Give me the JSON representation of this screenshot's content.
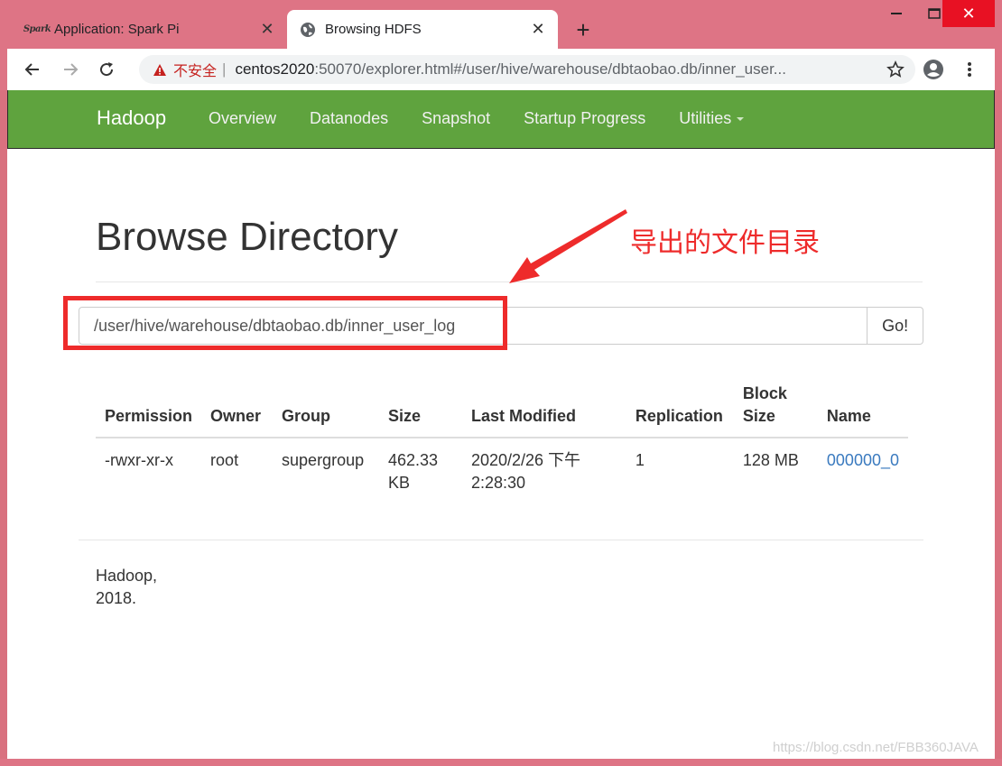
{
  "browser": {
    "tabs": [
      {
        "title": "Application: Spark Pi",
        "favicon": "spark-logo",
        "logo_text": "Spark",
        "active": false
      },
      {
        "title": "Browsing HDFS",
        "favicon": "globe-icon",
        "active": true
      }
    ],
    "new_tab_symbol": "+",
    "security_label": "不安全",
    "url_host": "centos2020",
    "url_rest": ":50070/explorer.html#/user/hive/warehouse/dbtaobao.db/inner_user..."
  },
  "navbar": {
    "brand": "Hadoop",
    "links": [
      "Overview",
      "Datanodes",
      "Snapshot",
      "Startup Progress",
      "Utilities"
    ],
    "color": "#5fa33e"
  },
  "page": {
    "title": "Browse Directory",
    "path_value": "/user/hive/warehouse/dbtaobao.db/inner_user_log",
    "go_label": "Go!"
  },
  "annotation": {
    "text": "导出的文件目录",
    "color": "#ee2b2b"
  },
  "table": {
    "headers": [
      "Permission",
      "Owner",
      "Group",
      "Size",
      "Last Modified",
      "Replication",
      "Block Size",
      "Name"
    ],
    "rows": [
      {
        "permission": "-rwxr-xr-x",
        "owner": "root",
        "group": "supergroup",
        "size": "462.33 KB",
        "last_modified": "2020/2/26 下午2:28:30",
        "replication": "1",
        "block_size": "128 MB",
        "name": "000000_0"
      }
    ]
  },
  "footer": {
    "line1": "Hadoop,",
    "line2": "2018."
  },
  "watermark": "https://blog.csdn.net/FBB360JAVA"
}
